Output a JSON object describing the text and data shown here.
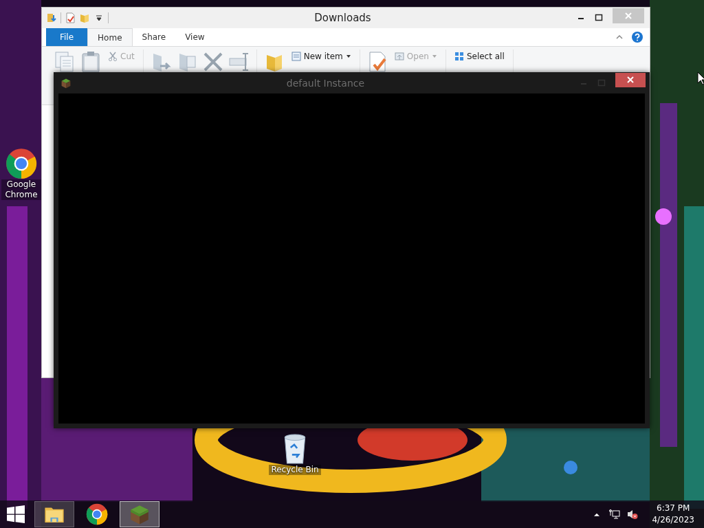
{
  "desktop_icons": [
    {
      "kind": "chrome",
      "label": "Google Chrome"
    },
    {
      "kind": "recycle-bin",
      "label": "Recycle Bin"
    }
  ],
  "explorer": {
    "title": "Downloads",
    "tabs": [
      {
        "label": "File",
        "kind": "file",
        "selected": false
      },
      {
        "label": "Home",
        "kind": "tab",
        "selected": true
      },
      {
        "label": "Share",
        "kind": "tab",
        "selected": false
      },
      {
        "label": "View",
        "kind": "tab",
        "selected": false
      }
    ],
    "ribbon_buttons": [
      {
        "label": "Cut",
        "dropdown": false,
        "disabled": true
      },
      {
        "label": "New item",
        "dropdown": true,
        "disabled": false
      },
      {
        "label": "Open",
        "dropdown": true,
        "disabled": true
      },
      {
        "label": "Select all",
        "dropdown": false,
        "disabled": false
      }
    ]
  },
  "game_window": {
    "title": "default Instance"
  },
  "taskbar": {
    "apps": [
      {
        "kind": "explorer",
        "selected": false
      },
      {
        "kind": "chrome",
        "selected": false
      },
      {
        "kind": "grass-block",
        "selected": true
      }
    ],
    "time": "6:37 PM",
    "date": "4/26/2023"
  }
}
